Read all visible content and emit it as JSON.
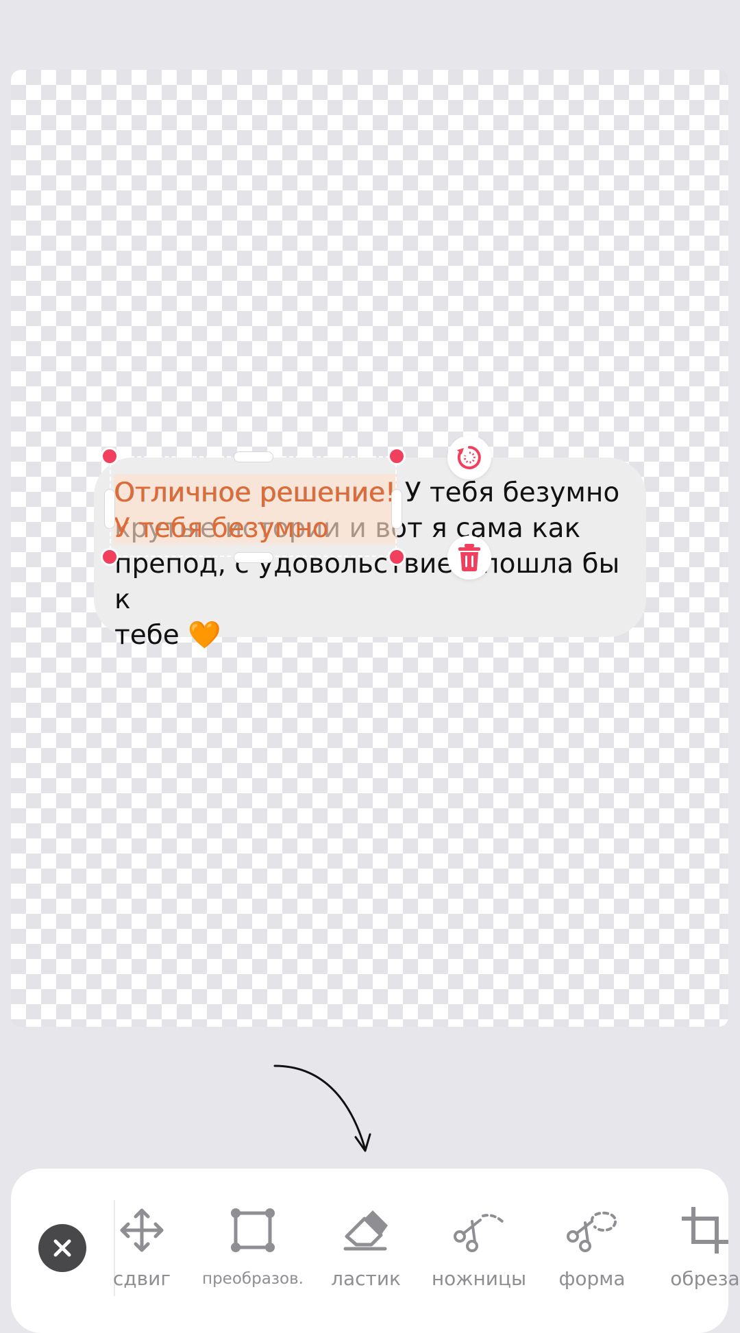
{
  "editor": {
    "bubble_text": "Отличное решение! У тебя безумно\nкрутые истории и вот я сама как\nпрепод, с удовольствием пошла бы к\nтебе 🧡",
    "selected_text": "Отличное решение! У тебя безумно\nкрутые истории и вот я сама как",
    "rotate_icon": "rotate-icon",
    "delete_icon": "trash-icon",
    "accent_color": "#f0405e",
    "selection_text_color": "#e06a35"
  },
  "toolbar": {
    "close_icon": "close-icon",
    "tools": [
      {
        "label": "сдвиг",
        "icon": "move-icon"
      },
      {
        "label": "преобразов.",
        "icon": "transform-icon"
      },
      {
        "label": "ластик",
        "icon": "eraser-icon"
      },
      {
        "label": "ножницы",
        "icon": "scissors-icon"
      },
      {
        "label": "форма",
        "icon": "shape-cut-icon"
      },
      {
        "label": "обреза",
        "icon": "crop-icon"
      }
    ]
  }
}
